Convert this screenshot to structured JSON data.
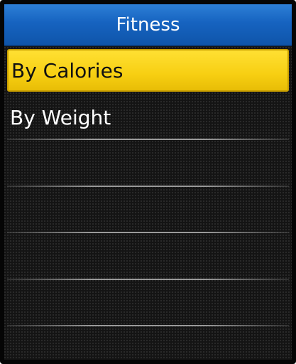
{
  "header": {
    "title": "Fitness"
  },
  "menu": {
    "items": [
      {
        "label": "By Calories",
        "selected": true
      },
      {
        "label": "By Weight",
        "selected": false
      }
    ]
  },
  "colors": {
    "title_bar": "#1663c0",
    "selected_item": "#f7cf12",
    "background": "#141414"
  }
}
